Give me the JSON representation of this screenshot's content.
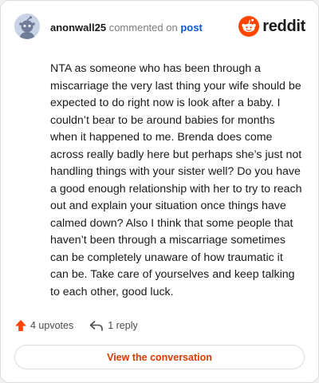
{
  "header": {
    "username": "anonwall25",
    "action_text": "commented on",
    "post_link": "post",
    "brand": "reddit"
  },
  "comment": {
    "body": "NTA as someone who has been through a miscarriage the very last thing your wife should be expected to do right now is look after a baby. I couldn’t bear to be around babies for months when it happened to me. Brenda does come across really badly here but perhaps she’s just not handling things with your sister well? Do you have a good enough relationship with her to try to reach out and explain your situation once things have calmed down? Also I think that some people that haven’t been through a miscarriage sometimes can be completely unaware of how traumatic it can be. Take care of yourselves and keep talking to each other, good luck."
  },
  "actions": {
    "upvotes": "4 upvotes",
    "replies": "1 reply",
    "upvote_icon": "upvote-arrow-icon",
    "reply_icon": "reply-arrow-icon"
  },
  "footer": {
    "view_label": "View the conversation"
  },
  "colors": {
    "brand_orange": "#ff4500",
    "link_blue": "#0b57d0",
    "cta_red": "#d93a00"
  }
}
